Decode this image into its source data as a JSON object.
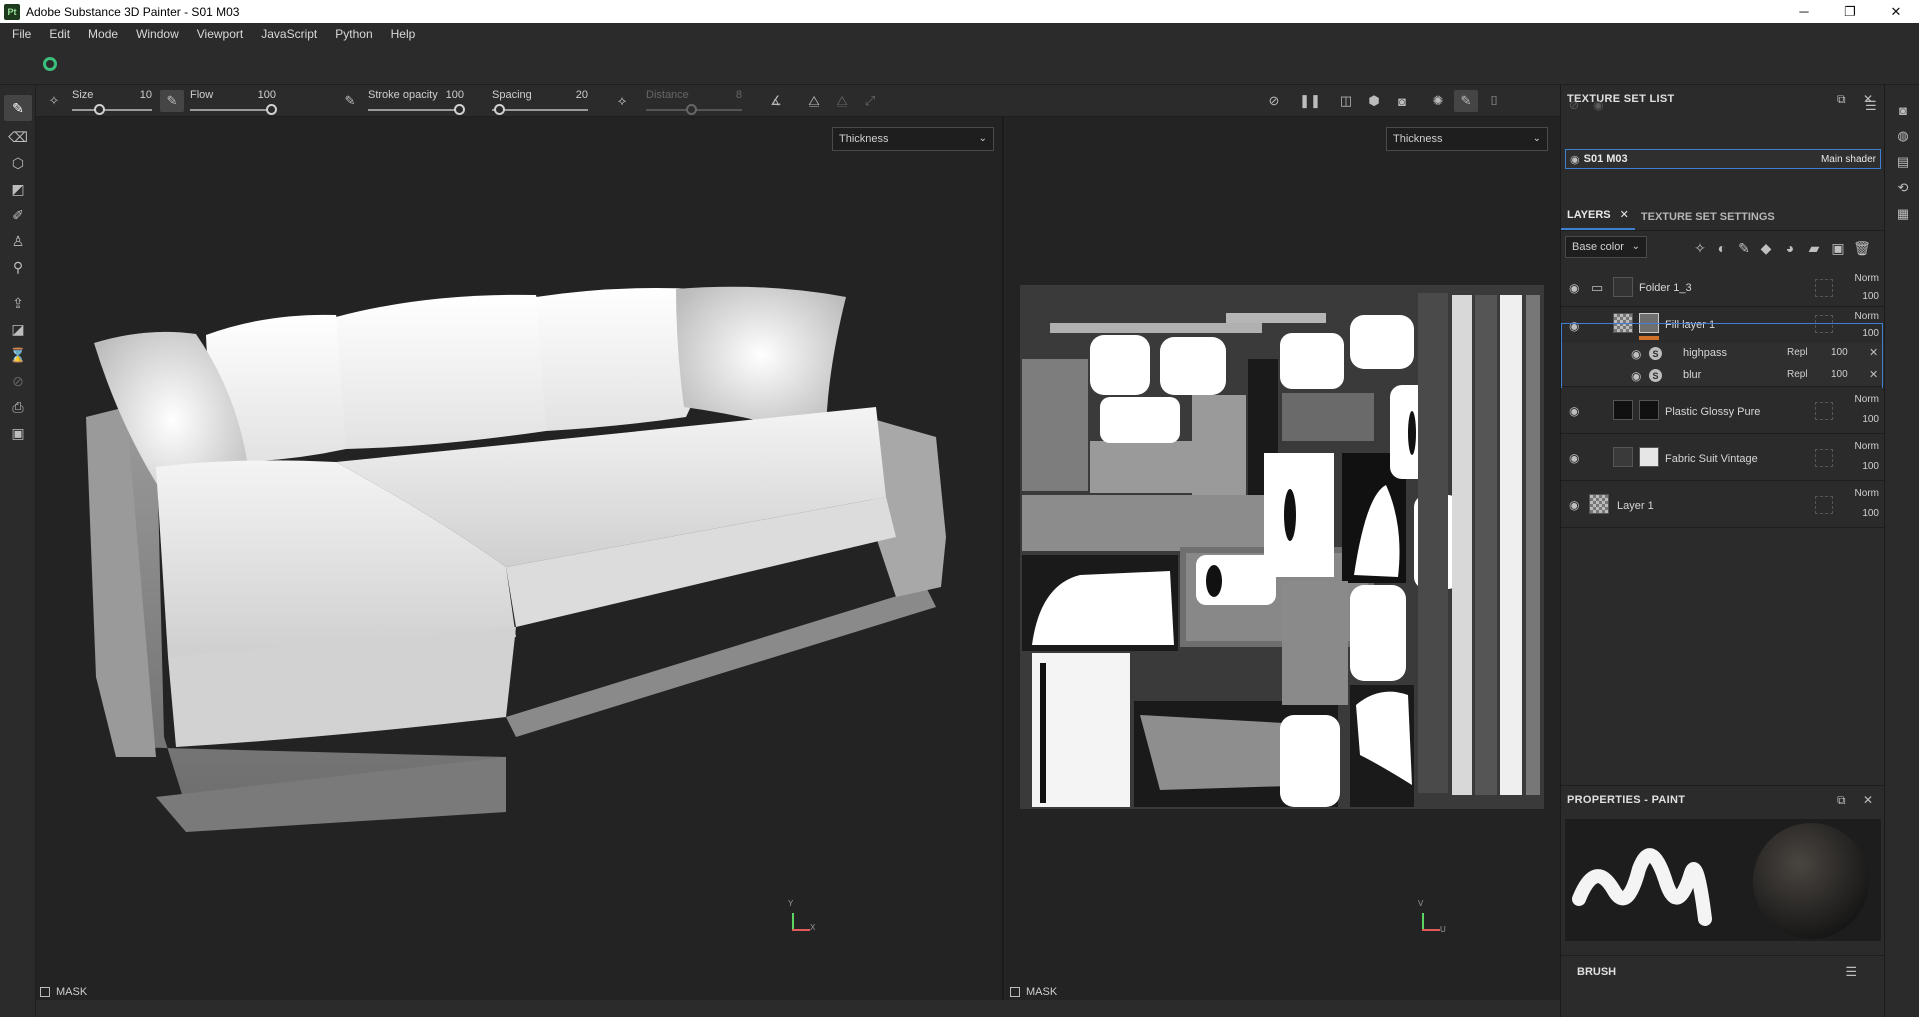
{
  "window": {
    "app_icon": "Pt",
    "title": "Adobe Substance 3D Painter - S01 M03",
    "minimize": "─",
    "maximize": "❐",
    "close": "✕"
  },
  "menu": [
    "File",
    "Edit",
    "Mode",
    "Window",
    "Viewport",
    "JavaScript",
    "Python",
    "Help"
  ],
  "brush_bar": {
    "size_label": "Size",
    "size_value": "10",
    "flow_label": "Flow",
    "flow_value": "100",
    "stroke_opacity_label": "Stroke opacity",
    "stroke_opacity_value": "100",
    "spacing_label": "Spacing",
    "spacing_value": "20",
    "distance_label": "Distance",
    "distance_value": "8"
  },
  "viewport_3d": {
    "channel": "Thickness",
    "mask_label": "MASK",
    "axis_y": "Y",
    "axis_x": "X"
  },
  "viewport_2d": {
    "channel": "Thickness",
    "mask_label": "MASK",
    "axis_v": "V",
    "axis_u": "U"
  },
  "texture_set_list": {
    "title": "TEXTURE SET LIST",
    "set_name": "S01 M03",
    "shader": "Main shader"
  },
  "layers_panel": {
    "tab_layers": "LAYERS",
    "tab_texture_settings": "TEXTURE SET SETTINGS",
    "channel": "Base color",
    "layers": [
      {
        "name": "Folder 1_3",
        "blend": "Norm",
        "opacity": "100"
      },
      {
        "name": "Fill layer 1",
        "blend": "Norm",
        "opacity": "100"
      },
      {
        "name": "Plastic Glossy Pure",
        "blend": "Norm",
        "opacity": "100"
      },
      {
        "name": "Fabric Suit Vintage",
        "blend": "Norm",
        "opacity": "100"
      },
      {
        "name": "Layer 1",
        "blend": "Norm",
        "opacity": "100"
      }
    ],
    "filters": [
      {
        "name": "highpass",
        "blend": "Repl",
        "opacity": "100"
      },
      {
        "name": "blur",
        "blend": "Repl",
        "opacity": "100"
      }
    ]
  },
  "properties": {
    "title": "PROPERTIES - PAINT",
    "brush_label": "BRUSH"
  },
  "colors": {
    "accent": "#3f7fd0",
    "panel_bg": "#2b2b2b",
    "viewport_bg": "#232323",
    "logo_green": "#3bbf7c",
    "fill_orange": "#d0722a"
  }
}
